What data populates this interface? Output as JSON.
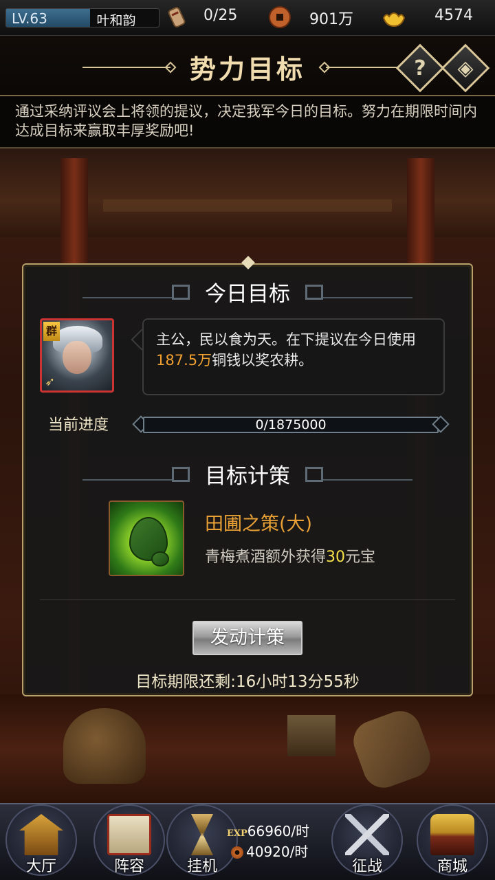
{
  "topbar": {
    "level": "LV.63",
    "level_progress": 0.55,
    "player_name": "叶和韵",
    "stamina": "0/25",
    "copper": "901万",
    "gold": "4574",
    "icons": [
      "scroll-icon",
      "copper-coin-icon",
      "gold-ingot-icon"
    ]
  },
  "header": {
    "title": "势力目标",
    "help_icon": "question-icon",
    "nav_icon": "diamond-arrow-icon"
  },
  "description": "通过采纳评议会上将领的提议，决定我军今日的目标。努力在期限时间内达成目标来赢取丰厚奖励吧!",
  "today_goal": {
    "section_title": "今日目标",
    "hero_faction": "群",
    "message_prefix": "主公，民以食为天。在下提议在今日使用",
    "message_amount": "187.5万",
    "message_suffix": "铜钱以奖农耕。"
  },
  "progress": {
    "label": "当前进度",
    "text": "0/1875000",
    "value": 0
  },
  "strategy": {
    "section_title": "目标计策",
    "name": "田圃之策(大)",
    "desc_prefix": "青梅煮酒额外获得",
    "desc_amount": "30",
    "desc_suffix": "元宝",
    "icon": "leaf-icon"
  },
  "launch_button": "发动计策",
  "deadline": "目标期限还剩:16小时13分55秒",
  "bottom_nav": {
    "hall": "大厅",
    "team": "阵容",
    "idle": "挂机",
    "war": "征战",
    "shop": "商城"
  },
  "income": {
    "exp_tag": "EXP",
    "exp_rate": "66960/时",
    "copper_rate": "40920/时"
  },
  "colors": {
    "accent_gold": "#d9c79a",
    "highlight_orange": "#f0a030",
    "highlight_yellow": "#f6e04a",
    "strategy_name": "#e9a035"
  }
}
